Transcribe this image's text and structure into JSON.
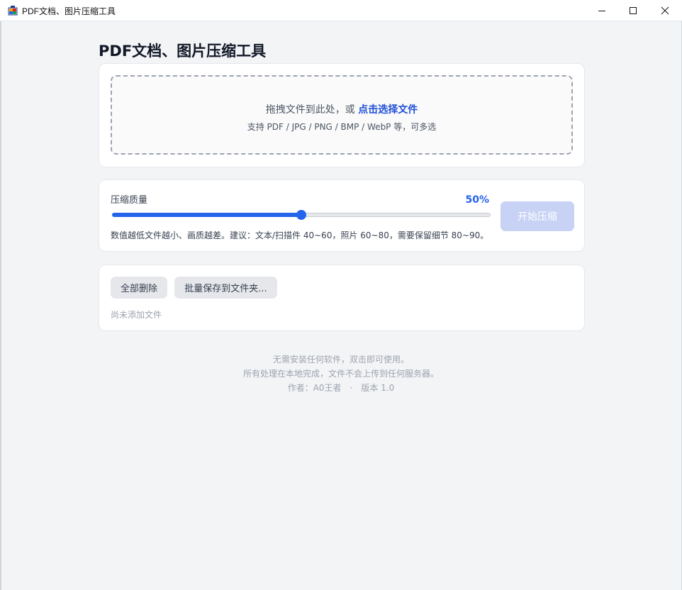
{
  "window": {
    "title": "PDF文档、图片压缩工具",
    "minimize_icon": "minimize-icon",
    "maximize_icon": "maximize-icon",
    "close_icon": "close-icon"
  },
  "page": {
    "title": "PDF文档、图片压缩工具"
  },
  "dropzone": {
    "prompt": "拖拽文件到此处，或 ",
    "link": "点击选择文件",
    "formats": "支持 PDF / JPG / PNG / BMP / WebP 等，可多选"
  },
  "quality": {
    "label": "压缩质量",
    "value": 50,
    "value_text": "50%",
    "min": 0,
    "max": 100,
    "hint": "数值越低文件越小、画质越差。建议：文本/扫描件 40~60，照片 60~80，需要保留细节 80~90。",
    "start_button": "开始压缩",
    "accent_color": "#2563eb"
  },
  "files": {
    "delete_all": "全部删除",
    "batch_save": "批量保存到文件夹...",
    "empty": "尚未添加文件"
  },
  "footer": {
    "line1": "无需安装任何软件，双击即可使用。",
    "line2": "所有处理在本地完成，文件不会上传到任何服务器。",
    "author": "作者：A0王者",
    "separator": "·",
    "version": "版本 1.0"
  }
}
